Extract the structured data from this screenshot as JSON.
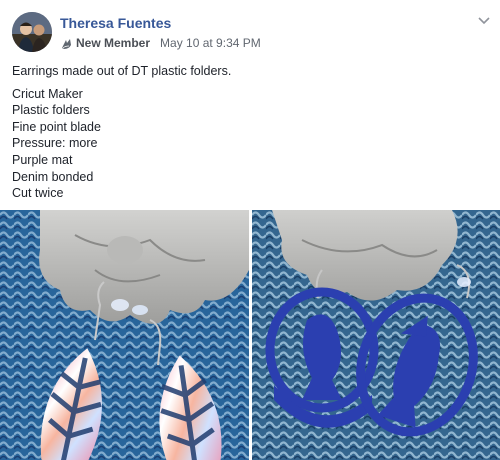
{
  "author": {
    "name": "Theresa Fuentes"
  },
  "meta": {
    "badge": "New Member",
    "timestamp": "May 10 at 9:34 PM"
  },
  "post": {
    "caption": "Earrings made out of DT plastic folders.",
    "details": [
      "Cricut Maker",
      "Plastic folders",
      "Fine point blade",
      "Pressure: more",
      "Purple mat",
      "Denim bonded",
      "Cut twice"
    ]
  },
  "icons": {
    "badge": "new-member-icon",
    "menu": "chevron-down-icon"
  },
  "colors": {
    "author_link": "#385898",
    "meta_text": "#616770",
    "earring_blue": "#2b3fb0"
  }
}
